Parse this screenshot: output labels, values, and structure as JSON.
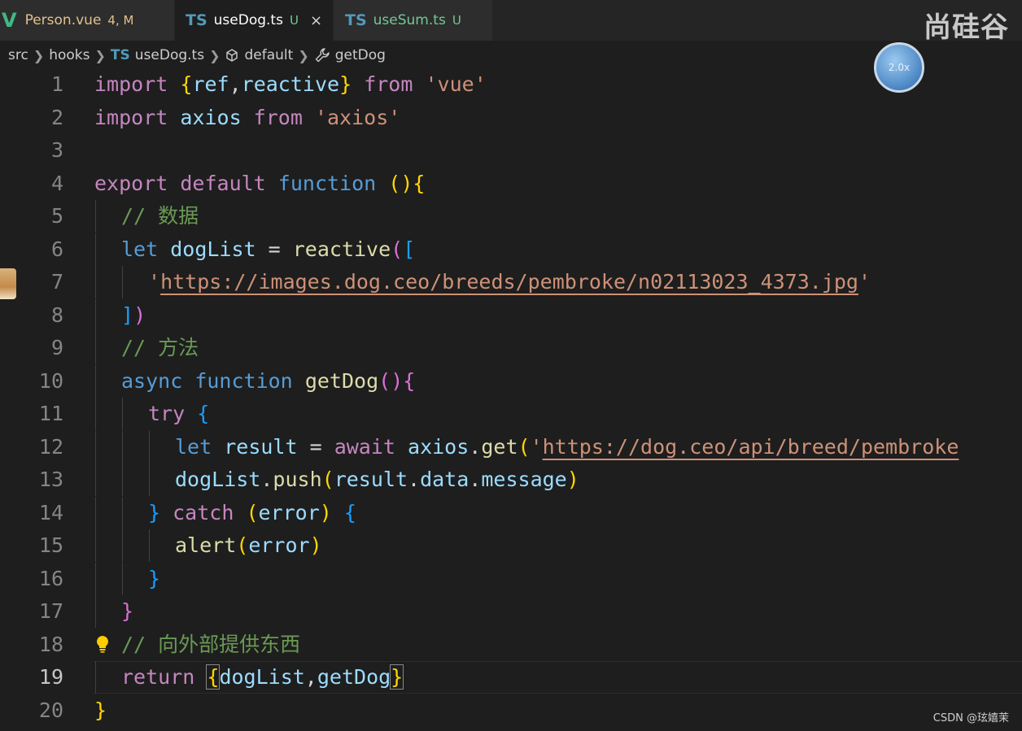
{
  "tabs": [
    {
      "icon": "V",
      "name": "Person.vue",
      "state": "4, M"
    },
    {
      "icon": "TS",
      "name": "useDog.ts",
      "state": "U",
      "close": "×"
    },
    {
      "icon": "TS",
      "name": "useSum.ts",
      "state": "U"
    }
  ],
  "watermark": "尚硅谷",
  "breadcrumb": {
    "items": [
      "src",
      "hooks",
      "useDog.ts",
      "default",
      "getDog"
    ],
    "ts_icon": "TS"
  },
  "float_ball_text": "2.0x",
  "code_lines": [
    {
      "num": "1"
    },
    {
      "num": "2"
    },
    {
      "num": "3"
    },
    {
      "num": "4"
    },
    {
      "num": "5"
    },
    {
      "num": "6"
    },
    {
      "num": "7"
    },
    {
      "num": "8"
    },
    {
      "num": "9"
    },
    {
      "num": "10"
    },
    {
      "num": "11"
    },
    {
      "num": "12"
    },
    {
      "num": "13"
    },
    {
      "num": "14"
    },
    {
      "num": "15"
    },
    {
      "num": "16"
    },
    {
      "num": "17"
    },
    {
      "num": "18"
    },
    {
      "num": "19"
    },
    {
      "num": "20"
    }
  ],
  "code": {
    "l1": [
      "import",
      " ",
      "{",
      "ref",
      ",",
      "reactive",
      "}",
      " ",
      "from",
      " ",
      "'vue'"
    ],
    "l2": [
      "import",
      " axios ",
      "from",
      " ",
      "'axios'"
    ],
    "l4": [
      "export",
      " ",
      "default",
      " ",
      "function",
      " ",
      "(",
      ")",
      "{"
    ],
    "l5": "// 数据",
    "l6": [
      "let",
      " ",
      "dogList",
      " = ",
      "reactive",
      "(",
      "["
    ],
    "l7": [
      "'",
      "https://images.dog.ceo/breeds/pembroke/n02113023_4373.jpg",
      "'"
    ],
    "l8": [
      "]",
      ")"
    ],
    "l9": "// 方法",
    "l10": [
      "async",
      " ",
      "function",
      " ",
      "getDog",
      "(",
      ")",
      "{"
    ],
    "l11": [
      "try",
      " ",
      "{"
    ],
    "l12": [
      "let",
      " ",
      "result",
      " = ",
      "await",
      " ",
      "axios",
      ".",
      "get",
      "(",
      "'",
      "https://dog.ceo/api/breed/pembroke"
    ],
    "l13": [
      "dogList",
      ".",
      "push",
      "(",
      "result",
      ".",
      "data",
      ".",
      "message",
      ")"
    ],
    "l14": [
      "}",
      " ",
      "catch",
      " ",
      "(",
      "error",
      ")",
      " ",
      "{"
    ],
    "l15": [
      "alert",
      "(",
      "error",
      ")"
    ],
    "l16": "}",
    "l17": "}",
    "l18": "// 向外部提供东西",
    "l19": [
      "return",
      " ",
      "{",
      "dogList",
      ",",
      "getDog",
      "}"
    ],
    "l20": "}"
  },
  "footer_watermark": "CSDN @玹嬉茉"
}
